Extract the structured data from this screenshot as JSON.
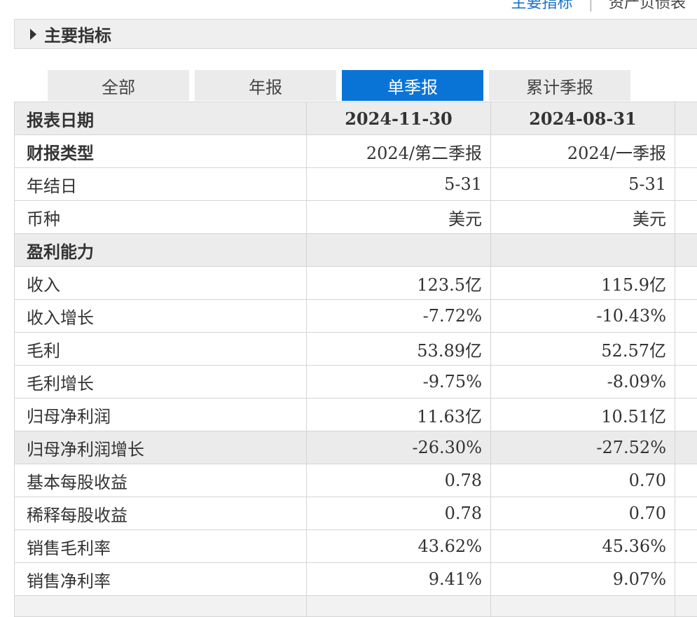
{
  "top_links": {
    "first": "主要指标",
    "separator": "|",
    "second": "资产负债表"
  },
  "section": {
    "title": "主要指标"
  },
  "tabs": [
    {
      "label": "全部",
      "active": false
    },
    {
      "label": "年报",
      "active": false
    },
    {
      "label": "单季报",
      "active": true
    },
    {
      "label": "累计季报",
      "active": false
    }
  ],
  "table": {
    "header": {
      "label": "报表日期",
      "col1": "2024-11-30",
      "col2": "2024-08-31"
    },
    "rows": [
      {
        "label": "财报类型",
        "col1": "2024/第二季报",
        "col2": "2024/一季报"
      },
      {
        "label": "年结日",
        "col1": "5-31",
        "col2": "5-31"
      },
      {
        "label": "币种",
        "col1": "美元",
        "col2": "美元"
      },
      {
        "label": "盈利能力",
        "col1": "",
        "col2": ""
      },
      {
        "label": "收入",
        "col1": "123.5亿",
        "col2": "115.9亿"
      },
      {
        "label": "收入增长",
        "col1": "-7.72%",
        "col2": "-10.43%"
      },
      {
        "label": "毛利",
        "col1": "53.89亿",
        "col2": "52.57亿"
      },
      {
        "label": "毛利增长",
        "col1": "-9.75%",
        "col2": "-8.09%"
      },
      {
        "label": "归母净利润",
        "col1": "11.63亿",
        "col2": "10.51亿"
      },
      {
        "label": "归母净利润增长",
        "col1": "-26.30%",
        "col2": "-27.52%"
      },
      {
        "label": "基本每股收益",
        "col1": "0.78",
        "col2": "0.70"
      },
      {
        "label": "稀释每股收益",
        "col1": "0.78",
        "col2": "0.70"
      },
      {
        "label": "销售毛利率",
        "col1": "43.62%",
        "col2": "45.36%"
      },
      {
        "label": "销售净利率",
        "col1": "9.41%",
        "col2": "9.07%"
      }
    ]
  }
}
